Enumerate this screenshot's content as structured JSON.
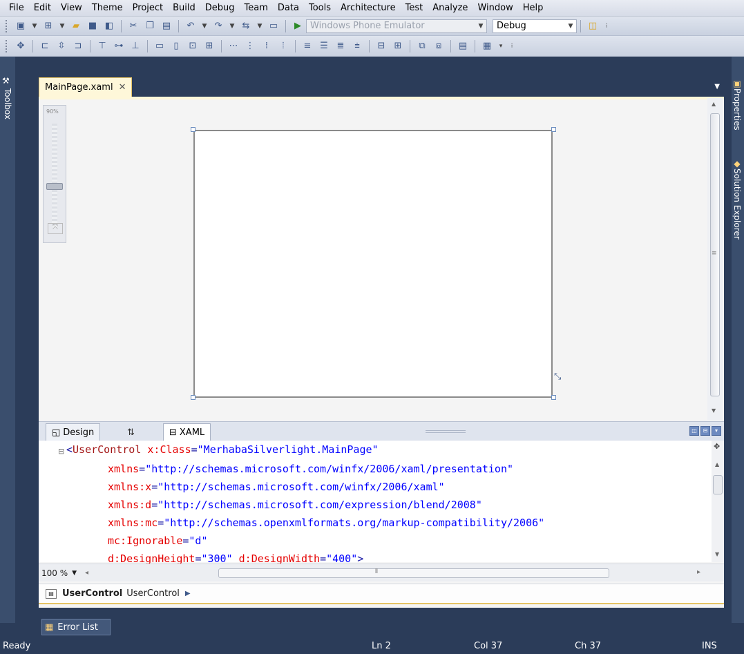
{
  "menu": [
    "File",
    "Edit",
    "View",
    "Theme",
    "Project",
    "Build",
    "Debug",
    "Team",
    "Data",
    "Tools",
    "Architecture",
    "Test",
    "Analyze",
    "Window",
    "Help"
  ],
  "toolbar": {
    "target_combo": "Windows Phone Emulator",
    "config_combo": "Debug"
  },
  "left_panel": {
    "toolbox_label": "Toolbox"
  },
  "right_panel": {
    "properties_label": "Properties",
    "solution_label": "Solution Explorer"
  },
  "document": {
    "tab_label": "MainPage.xaml",
    "close_glyph": "✕",
    "zoom_slider_label": "90%"
  },
  "split": {
    "design_label": "Design",
    "swap_label": "⇅",
    "xaml_label": "XAML"
  },
  "code": {
    "line1_tag": "UserControl",
    "line1_attr": "x:Class",
    "line1_val": "\"MerhabaSilverlight.MainPage\"",
    "line2_attr": "xmlns",
    "line2_val": "\"http://schemas.microsoft.com/winfx/2006/xaml/presentation\"",
    "line3_attr": "xmlns:x",
    "line3_val": "\"http://schemas.microsoft.com/winfx/2006/xaml\"",
    "line4_attr": "xmlns:d",
    "line4_val": "\"http://schemas.microsoft.com/expression/blend/2008\"",
    "line5_attr": "xmlns:mc",
    "line5_val": "\"http://schemas.openxmlformats.org/markup-compatibility/2006\"",
    "line6_attr": "mc:Ignorable",
    "line6_val": "\"d\"",
    "line7_attr1": "d:DesignHeight",
    "line7_val1": "\"300\"",
    "line7_attr2": "d:DesignWidth",
    "line7_val2": "\"400\""
  },
  "editor_zoom": "100 %",
  "breadcrumb": {
    "bold": "UserControl",
    "plain": "UserControl"
  },
  "error_list_label": "Error List",
  "status": {
    "state": "Ready",
    "line": "Ln 2",
    "col": "Col 37",
    "ch": "Ch 37",
    "mode": "INS"
  },
  "colors": {
    "accent_tab": "#fef7d9",
    "chrome": "#2b3c59"
  }
}
